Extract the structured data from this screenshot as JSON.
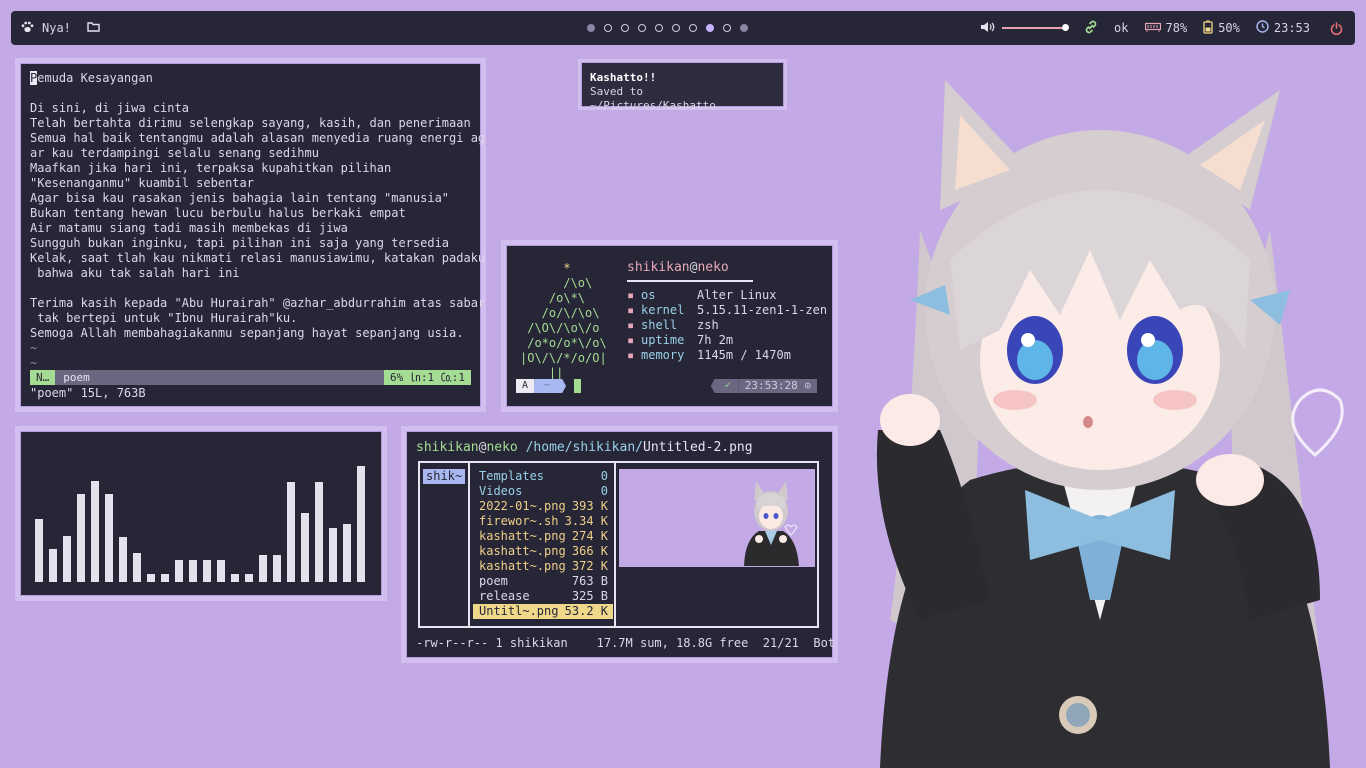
{
  "topbar": {
    "launcher_label": "Nya!",
    "volume_percent": 100,
    "network_label": "ok",
    "memory_label": "78%",
    "battery_label": "50%",
    "clock_label": "23:53",
    "workspaces": [
      {
        "state": "filled"
      },
      {
        "state": "empty"
      },
      {
        "state": "empty"
      },
      {
        "state": "empty"
      },
      {
        "state": "empty"
      },
      {
        "state": "empty"
      },
      {
        "state": "empty"
      },
      {
        "state": "active"
      },
      {
        "state": "empty"
      },
      {
        "state": "filled"
      }
    ]
  },
  "notification": {
    "title": "Kashatto!!",
    "body": "Saved to ~/Pictures/Kashatto"
  },
  "poem_editor": {
    "first_char": "P",
    "lines": [
      "emuda Kesayangan",
      "",
      "Di sini, di jiwa cinta",
      "Telah bertahta dirimu selengkap sayang, kasih, dan penerimaan",
      "Semua hal baik tentangmu adalah alasan menyedia ruang energi ag",
      "ar kau terdampingi selalu senang sedihmu",
      "Maafkan jika hari ini, terpaksa kupahitkan pilihan",
      "\"Kesenanganmu\" kuambil sebentar",
      "Agar bisa kau rasakan jenis bahagia lain tentang \"manusia\"",
      "Bukan tentang hewan lucu berbulu halus berkaki empat",
      "Air matamu siang tadi masih membekas di jiwa",
      "Sungguh bukan inginku, tapi pilihan ini saja yang tersedia",
      "Kelak, saat tlah kau nikmati relasi manusiawimu, katakan padaku",
      " bahwa aku tak salah hari ini",
      "",
      "Terima kasih kepada \"Abu Hurairah\" @azhar_abdurrahim atas sabar",
      " tak bertepi untuk \"Ibnu Hurairah\"ku.",
      "Semoga Allah membahagiakanmu sepanjang hayat sepanjang usia."
    ],
    "tildes": [
      "~",
      "~"
    ],
    "status": {
      "mode": "N…",
      "filename": "poem",
      "position": "6% ㏑:1 ㏇:1"
    },
    "message": "\"poem\" 15L, 763B"
  },
  "fetch": {
    "tree_star": "*",
    "tree_lines": [
      " /\\o\\",
      " /o\\*\\",
      " /o/\\/\\o\\",
      "/\\O\\/\\o\\/o",
      "/o*o/o*\\/o\\",
      "|O\\/\\/*/o/O|",
      "    ||"
    ],
    "user": "shikikan",
    "host": "neko",
    "rows": [
      {
        "key": "os",
        "value": "Alter Linux"
      },
      {
        "key": "kernel",
        "value": "5.15.11-zen1-1-zen"
      },
      {
        "key": "shell",
        "value": "zsh"
      },
      {
        "key": "uptime",
        "value": "7h 2m"
      },
      {
        "key": "memory",
        "value": "1145m / 1470m"
      }
    ],
    "prompt_a": "A",
    "prompt_b": "~",
    "prompt_ok": "✓",
    "prompt_time": "23:53:28 ⊙"
  },
  "visualizer": {
    "levels": [
      0.49,
      0.26,
      0.36,
      0.69,
      0.79,
      0.69,
      0.35,
      0.23,
      0.06,
      0.06,
      0.17,
      0.17,
      0.17,
      0.17,
      0.06,
      0.06,
      0.21,
      0.21,
      0.78,
      0.54,
      0.78,
      0.42,
      0.45,
      0.91
    ]
  },
  "file_manager": {
    "user": "shikikan",
    "host": "neko",
    "path": "/home/shikikan/",
    "file": "Untitled-2.png",
    "parent_selected": "shik~",
    "entries": [
      {
        "name": "Templates",
        "size": "0",
        "kind": "dir"
      },
      {
        "name": "Videos",
        "size": "0",
        "kind": "dir"
      },
      {
        "name": "2022-01~.png",
        "size": "393 K",
        "kind": "img"
      },
      {
        "name": "firewor~.sh",
        "size": "3.34 K",
        "kind": "img"
      },
      {
        "name": "kashatt~.png",
        "size": "274 K",
        "kind": "img"
      },
      {
        "name": "kashatt~.png",
        "size": "366 K",
        "kind": "img"
      },
      {
        "name": "kashatt~.png",
        "size": "372 K",
        "kind": "img"
      },
      {
        "name": "poem",
        "size": "763 B",
        "kind": "plain"
      },
      {
        "name": "release",
        "size": "325 B",
        "kind": "plain"
      },
      {
        "name": "Untitl~.png",
        "size": "53.2 K",
        "kind": "sel"
      }
    ],
    "status": "-rw-r--r-- 1 shikikan    17.7M sum, 18.8G free  21/21  Bot"
  },
  "colors": {
    "wallpaper": "#c3a9e6",
    "bar_bg": "#262637",
    "window_border": "#d2bff0",
    "accent_green": "#a5dc94",
    "accent_pink": "#e8a7b8",
    "accent_blue": "#9ad0e8",
    "accent_yellow": "#f0d88a"
  }
}
